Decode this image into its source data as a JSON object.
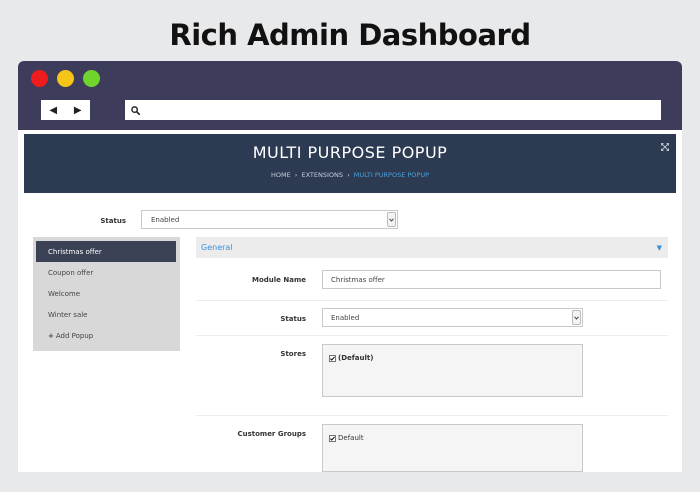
{
  "headline": "Rich Admin Dashboard",
  "browser": {
    "back_glyph": "◀",
    "forward_glyph": "▶",
    "search_icon": "search-icon"
  },
  "page": {
    "title": "MULTI PURPOSE POPUP",
    "breadcrumb": [
      "HOME",
      "EXTENSIONS",
      "MULTI PURPOSE POPUP"
    ],
    "breadcrumb_sep": "›"
  },
  "status_filter": {
    "label": "Status",
    "value": "Enabled"
  },
  "popups": {
    "items": [
      "Christmas offer",
      "Coupon offer",
      "Welcome",
      "Winter sale"
    ],
    "active": "Christmas offer",
    "add_label": "Add Popup",
    "add_icon": "+"
  },
  "section": {
    "title": "General"
  },
  "form": {
    "module_name": {
      "label": "Module Name",
      "value": "Christmas offer"
    },
    "status": {
      "label": "Status",
      "value": "Enabled"
    },
    "stores": {
      "label": "Stores",
      "option": "(Default)",
      "checked": true
    },
    "customer_groups": {
      "label": "Customer Groups",
      "option": "Default",
      "checked": true
    }
  },
  "colors": {
    "window_frame": "#3e3c5b",
    "hero": "#2c3a52",
    "link_blue": "#3b8fd6",
    "dot_red": "#ee1c1c",
    "dot_yellow": "#f5c518",
    "dot_green": "#6fd52c"
  }
}
